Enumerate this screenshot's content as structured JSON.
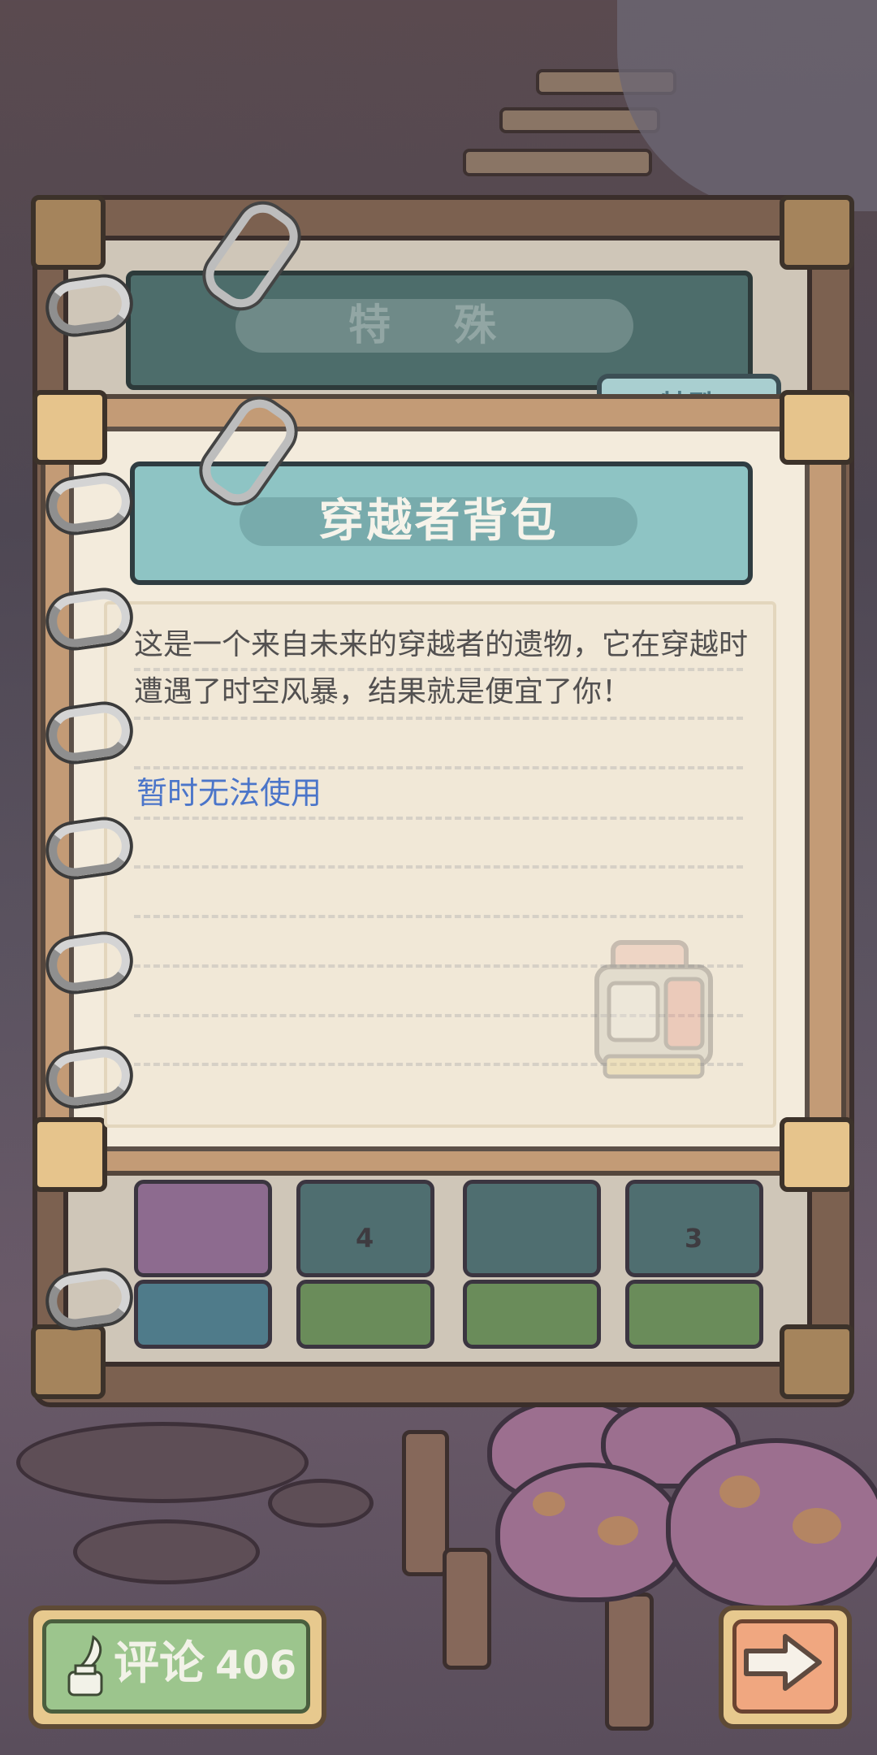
{
  "back_notebook": {
    "title": "特 殊",
    "tile_counts": [
      "4",
      "3"
    ]
  },
  "tab": {
    "label": "特殊"
  },
  "item_card": {
    "title": "穿越者背包",
    "description": "这是一个来自未来的穿越者的遗物，它在穿越时遭遇了时空风暴，结果就是便宜了你！",
    "status": "暂时无法使用",
    "status_color": "#4b75c9",
    "image_icon": "backpack-icon"
  },
  "footer": {
    "comment_label": "评论",
    "comment_count": "406",
    "comment_icon": "quill-inkpot-icon",
    "next_icon": "arrow-right-icon"
  }
}
